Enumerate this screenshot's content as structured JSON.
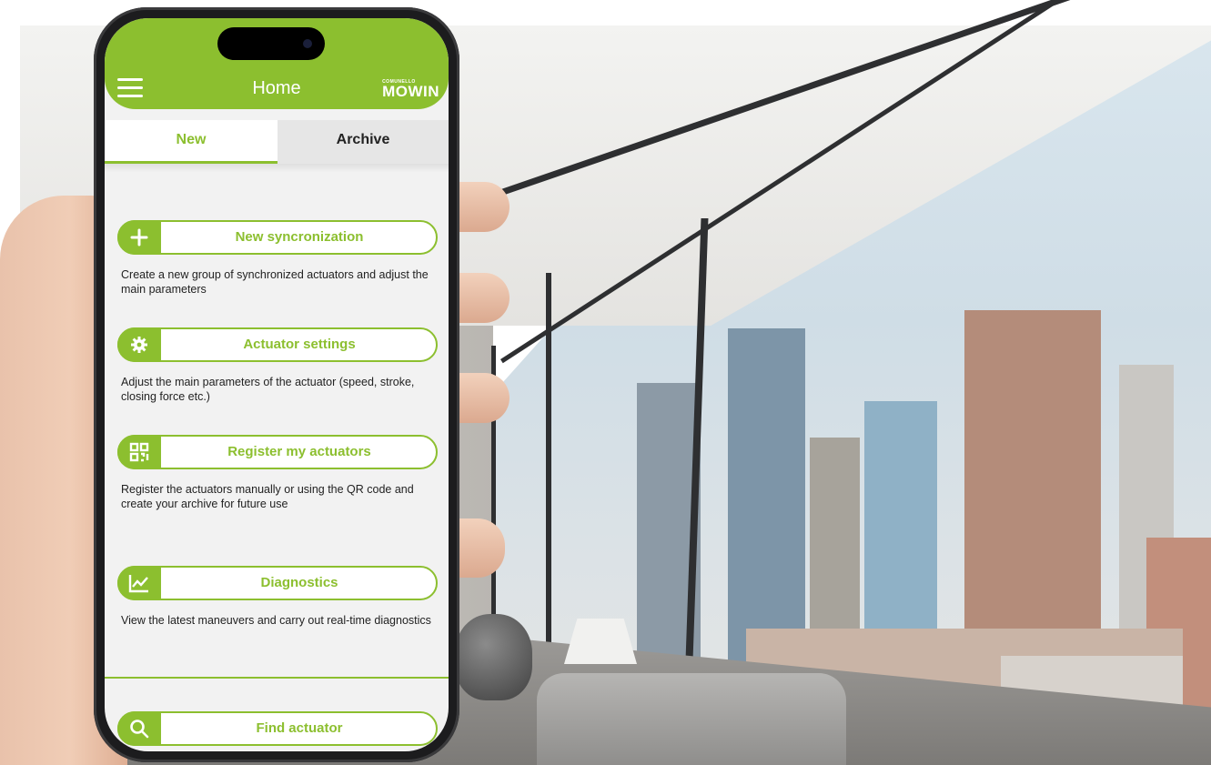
{
  "appbar": {
    "title": "Home",
    "brand_sub": "COMUNELLO",
    "brand_main": "MOWIN"
  },
  "tabs": [
    {
      "label": "New",
      "active": true
    },
    {
      "label": "Archive",
      "active": false
    }
  ],
  "actions": [
    {
      "label": "New syncronization",
      "icon": "plus-icon",
      "description": "Create a new group of synchronized actuators and adjust the main parameters"
    },
    {
      "label": "Actuator settings",
      "icon": "gear-icon",
      "description": "Adjust the main parameters of the actuator (speed, stroke, closing force etc.)"
    },
    {
      "label": "Register my actuators",
      "icon": "qr-code-icon",
      "description": "Register the actuators manually or using the QR code and create your archive for future use"
    },
    {
      "label": "Diagnostics",
      "icon": "chart-icon",
      "description": "View the latest maneuvers and carry out real-time diagnostics"
    }
  ],
  "find": {
    "label": "Find actuator",
    "icon": "search-icon"
  },
  "colors": {
    "accent": "#8cbf2f",
    "tab_inactive_bg": "#e6e6e6",
    "screen_bg": "#f2f2f2"
  }
}
